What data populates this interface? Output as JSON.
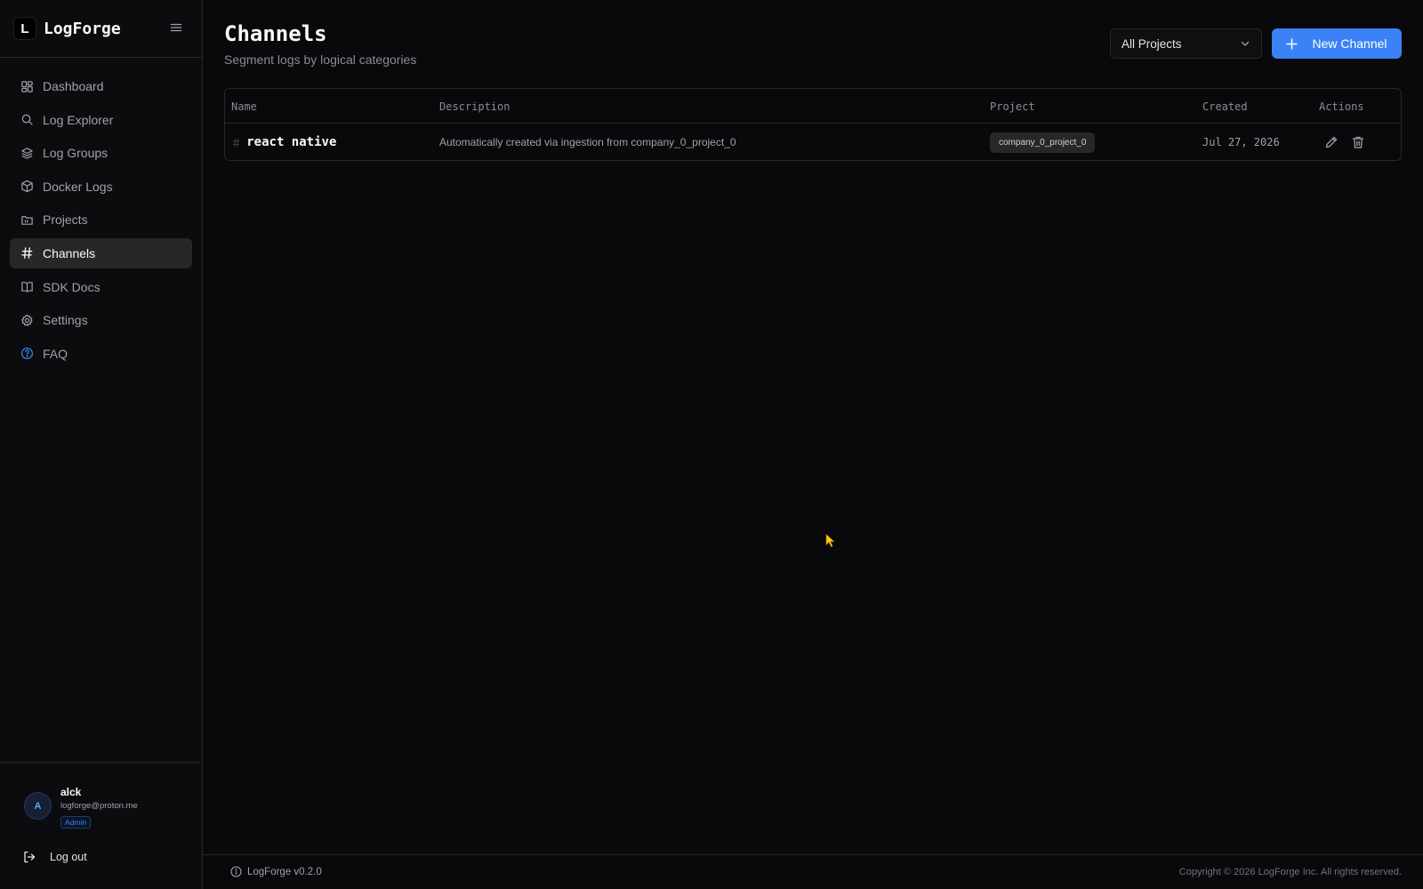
{
  "brand": {
    "logo_letter": "L",
    "name": "LogForge"
  },
  "sidebar": {
    "items": [
      {
        "label": "Dashboard",
        "icon": "dashboard-icon"
      },
      {
        "label": "Log Explorer",
        "icon": "search-icon"
      },
      {
        "label": "Log Groups",
        "icon": "layers-icon"
      },
      {
        "label": "Docker Logs",
        "icon": "box-icon"
      },
      {
        "label": "Projects",
        "icon": "folder-icon"
      },
      {
        "label": "Channels",
        "icon": "hash-icon",
        "active": true
      },
      {
        "label": "SDK Docs",
        "icon": "book-icon"
      },
      {
        "label": "Settings",
        "icon": "gear-icon"
      },
      {
        "label": "FAQ",
        "icon": "help-circle-icon"
      }
    ]
  },
  "user": {
    "initial": "A",
    "name": "alck",
    "email": "logforge@proton.me",
    "role": "Admin",
    "logout_label": "Log out"
  },
  "header": {
    "title": "Channels",
    "subtitle": "Segment logs by logical categories",
    "project_filter": "All Projects",
    "new_channel_label": "New Channel"
  },
  "table": {
    "columns": [
      "Name",
      "Description",
      "Project",
      "Created",
      "Actions"
    ],
    "rows": [
      {
        "name": "react native",
        "description": "Automatically created via ingestion from company_0_project_0",
        "project": "company_0_project_0",
        "created": "Jul 27, 2026"
      }
    ]
  },
  "footer": {
    "version": "LogForge v0.2.0",
    "copyright": "Copyright © 2026 LogForge Inc. All rights reserved."
  },
  "colors": {
    "accent": "#3b82f6",
    "background": "#09090b",
    "sidebar": "#0c0c0e",
    "border": "#27272a",
    "cursor": "#facc15"
  }
}
